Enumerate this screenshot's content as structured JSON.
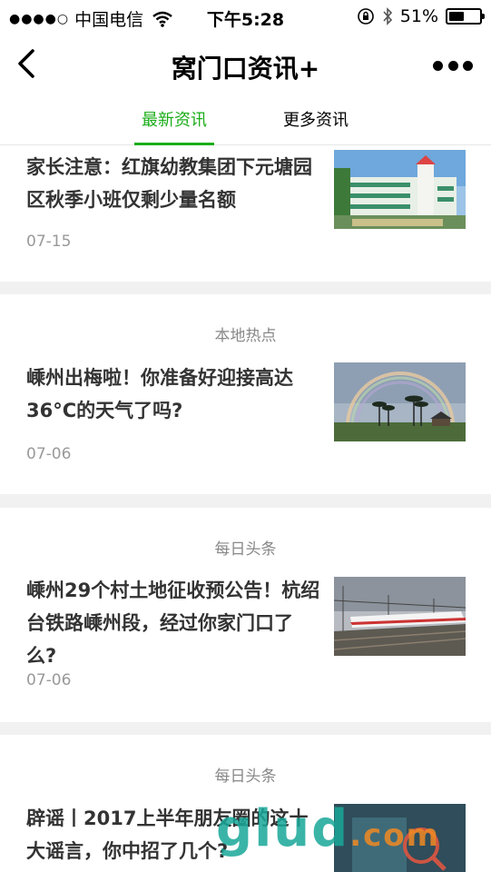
{
  "status_bar": {
    "signal": "●●●●○",
    "carrier": "中国电信",
    "time": "下午5:28",
    "battery": "51%",
    "battery_level": 0.51
  },
  "nav": {
    "title": "窝门口资讯+"
  },
  "tabs": [
    {
      "label": "最新资讯",
      "active": true
    },
    {
      "label": "更多资讯",
      "active": false
    }
  ],
  "articles": [
    {
      "section": "",
      "headline": "家长注意：红旗幼教集团下元塘园区秋季小班仅剩少量名额",
      "date": "07-15"
    },
    {
      "section": "本地热点",
      "headline": "嵊州出梅啦！你准备好迎接高达36°C的天气了吗?",
      "date": "07-06"
    },
    {
      "section": "每日头条",
      "headline": "嵊州29个村土地征收预公告！杭绍台铁路嵊州段，经过你家门口了么?",
      "date": "07-06"
    },
    {
      "section": "每日头条",
      "headline": "辟谣丨2017上半年朋友圈的这十大谣言，你中招了几个?",
      "date": ""
    }
  ],
  "watermark": {
    "main": "glud",
    "suffix": ".com"
  },
  "colors": {
    "accent": "#1aad19",
    "section_text": "#888888",
    "date_text": "#999999"
  }
}
